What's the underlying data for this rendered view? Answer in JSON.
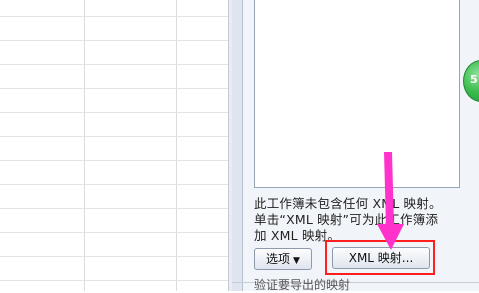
{
  "xml_pane": {
    "info_lines": [
      "此工作簿未包含任何 XML 映射。",
      "单击“XML 映射”可为此工作簿添",
      "加 XML 映射。"
    ],
    "options_button": "选项",
    "xml_maps_button": "XML 映射...",
    "bottom_link": "验证要导出的映射"
  },
  "annotation": {
    "arrow_color": "#ff33cc",
    "highlight_color": "#ff1f1f"
  },
  "icons": {
    "green_side_button": "5"
  }
}
